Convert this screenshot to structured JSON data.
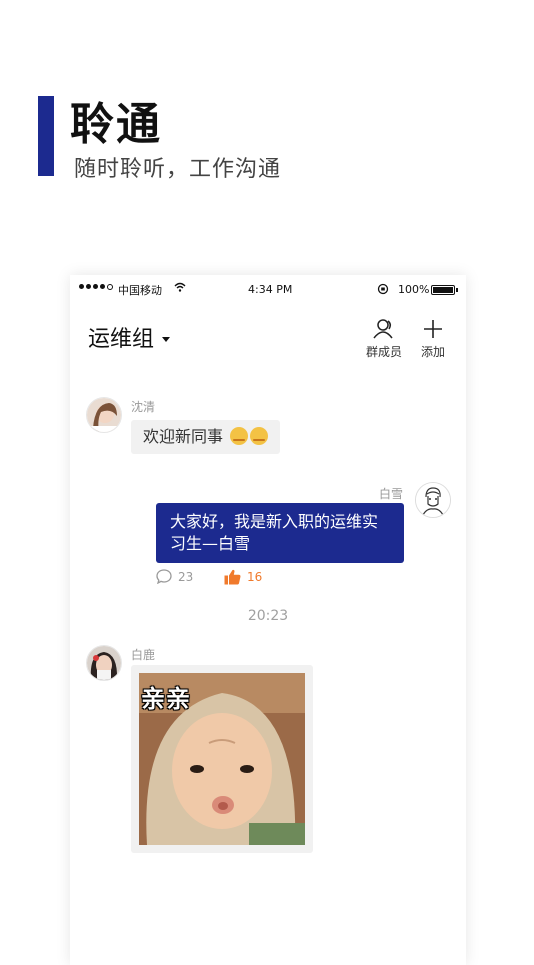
{
  "hero": {
    "title": "聆通",
    "subtitle": "随时聆听，工作沟通"
  },
  "status_bar": {
    "carrier": "中国移动",
    "time": "4:34 PM",
    "battery": "100%"
  },
  "nav": {
    "title": "运维组",
    "members_label": "群成员",
    "add_label": "添加"
  },
  "messages": [
    {
      "sender": "沈清",
      "text": "欢迎新同事"
    },
    {
      "sender": "白雪",
      "text": "大家好，我是新入职的运维实习生—白雪",
      "comments": "23",
      "likes": "16"
    },
    {
      "timestamp": "20:23"
    },
    {
      "sender": "白鹿",
      "sticker_caption": "亲亲"
    }
  ],
  "colors": {
    "brand": "#1c2a8f",
    "like": "#f07a2c"
  },
  "icons": [
    "members-icon",
    "plus-icon",
    "comment-icon",
    "thumbs-up-icon",
    "wifi-icon",
    "lock-rotation-icon",
    "battery-icon"
  ]
}
